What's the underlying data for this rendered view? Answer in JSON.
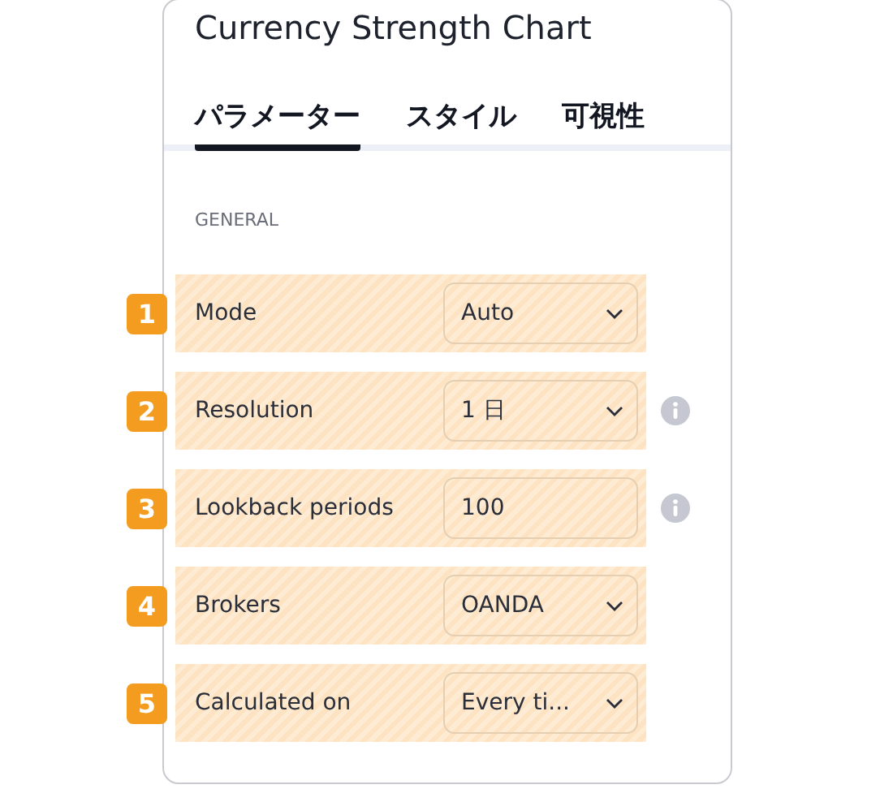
{
  "title": "Currency Strength Chart",
  "tabs": [
    {
      "label": "パラメーター",
      "selected": true
    },
    {
      "label": "スタイル",
      "selected": false
    },
    {
      "label": "可視性",
      "selected": false
    }
  ],
  "section": "GENERAL",
  "fields": [
    {
      "badge": "1",
      "label": "Mode",
      "kind": "select",
      "value": "Auto",
      "info": false
    },
    {
      "badge": "2",
      "label": "Resolution",
      "kind": "select",
      "value": "1 日",
      "info": true
    },
    {
      "badge": "3",
      "label": "Lookback periods",
      "kind": "input",
      "value": "100",
      "info": true
    },
    {
      "badge": "4",
      "label": "Brokers",
      "kind": "select",
      "value": "OANDA",
      "info": false
    },
    {
      "badge": "5",
      "label": "Calculated on",
      "kind": "select",
      "value": "Every ti...",
      "info": false
    }
  ]
}
